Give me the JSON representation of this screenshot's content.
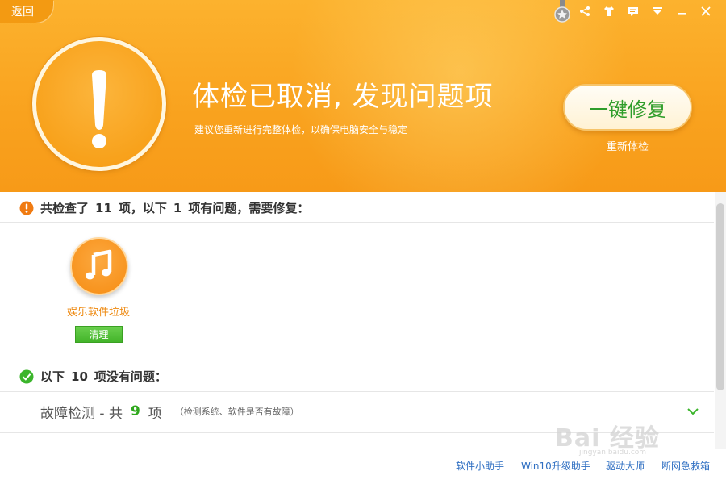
{
  "header": {
    "back_label": "返回",
    "headline": "体检已取消, 发现问题项",
    "subline": "建议您重新进行完整体检，以确保电脑安全与稳定",
    "fix_button_label": "一键修复",
    "recheck_label": "重新体检",
    "top_icons": [
      "medal-icon",
      "share-icon",
      "skin-icon",
      "feedback-icon",
      "menu-icon",
      "minimize-icon",
      "close-icon"
    ]
  },
  "problems": {
    "summary_prefix": "共检查了",
    "checked_count": "11",
    "summary_middle": "项，以下",
    "problem_count": "1",
    "summary_suffix": "项有问题，需要修复：",
    "items": [
      {
        "icon": "music-note-icon",
        "label": "娱乐软件垃圾",
        "action_label": "清理"
      }
    ]
  },
  "ok_section": {
    "prefix": "以下",
    "ok_count": "10",
    "suffix": "项没有问题：",
    "rows": [
      {
        "title": "故障检测 -  共",
        "count": "9",
        "unit": "项",
        "desc": "（检测系统、软件是否有故障）"
      }
    ]
  },
  "footer": {
    "links": [
      "软件小助手",
      "Win10升级助手",
      "驱动大师",
      "断网急救箱"
    ]
  },
  "watermark": {
    "text": "Bai 经验",
    "sub": "jingyan.baidu.com"
  },
  "colors": {
    "header_orange": "#f9a21e",
    "accent_green": "#2fa81d",
    "warning_orange": "#f07b12",
    "link_blue": "#2f6fc2"
  }
}
